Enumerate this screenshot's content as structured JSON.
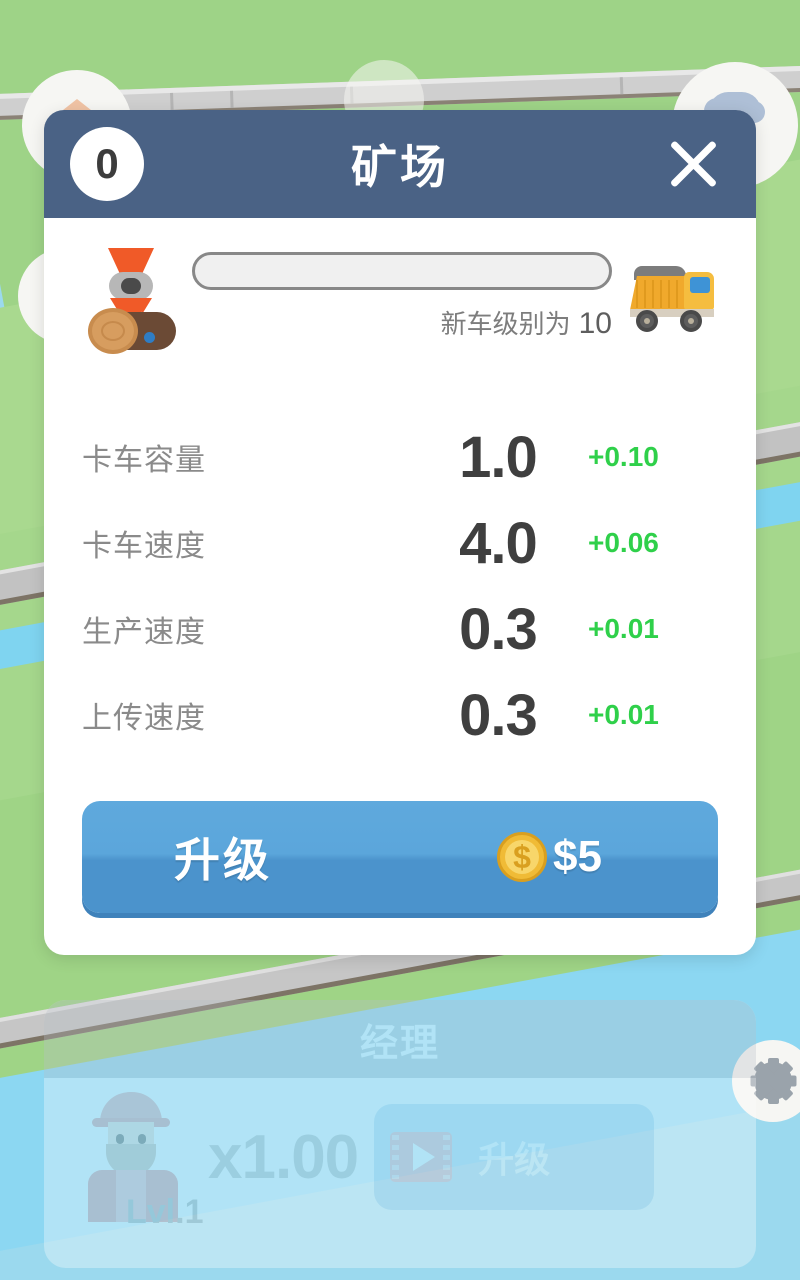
{
  "modal": {
    "level_badge": "0",
    "title": "矿场",
    "close_icon": "close-icon",
    "progress": {
      "source_icon": "log-grabber-icon",
      "target_icon": "dump-truck-icon",
      "fill_percent": 0,
      "caption_text": "新车级别为",
      "caption_value": "10"
    },
    "stats": [
      {
        "label": "卡车容量",
        "value": "1.0",
        "delta": "+0.10"
      },
      {
        "label": "卡车速度",
        "value": "4.0",
        "delta": "+0.06"
      },
      {
        "label": "生产速度",
        "value": "0.3",
        "delta": "+0.01"
      },
      {
        "label": "上传速度",
        "value": "0.3",
        "delta": "+0.01"
      }
    ],
    "upgrade": {
      "label": "升级",
      "coin_icon": "coin-icon",
      "coin_symbol": "$",
      "cost": "$5"
    }
  },
  "manager_panel": {
    "title": "经理",
    "avatar_icon": "manager-avatar",
    "level": "Lvl.1",
    "multiplier": "x1.00",
    "video_icon": "video-ad-icon",
    "upgrade_label": "升级"
  },
  "background": {
    "settings_icon": "gear-icon",
    "house_icon": "house-icon",
    "tree_icon": "tree-icon",
    "colors": {
      "grass": "#9ed387",
      "water": "#8cd7f2",
      "road": "#c2c2c2",
      "header": "#4a6285",
      "accent_blue": "#5fa9dd",
      "delta_green": "#2fd04a",
      "coin_gold": "#f0bb36"
    }
  }
}
